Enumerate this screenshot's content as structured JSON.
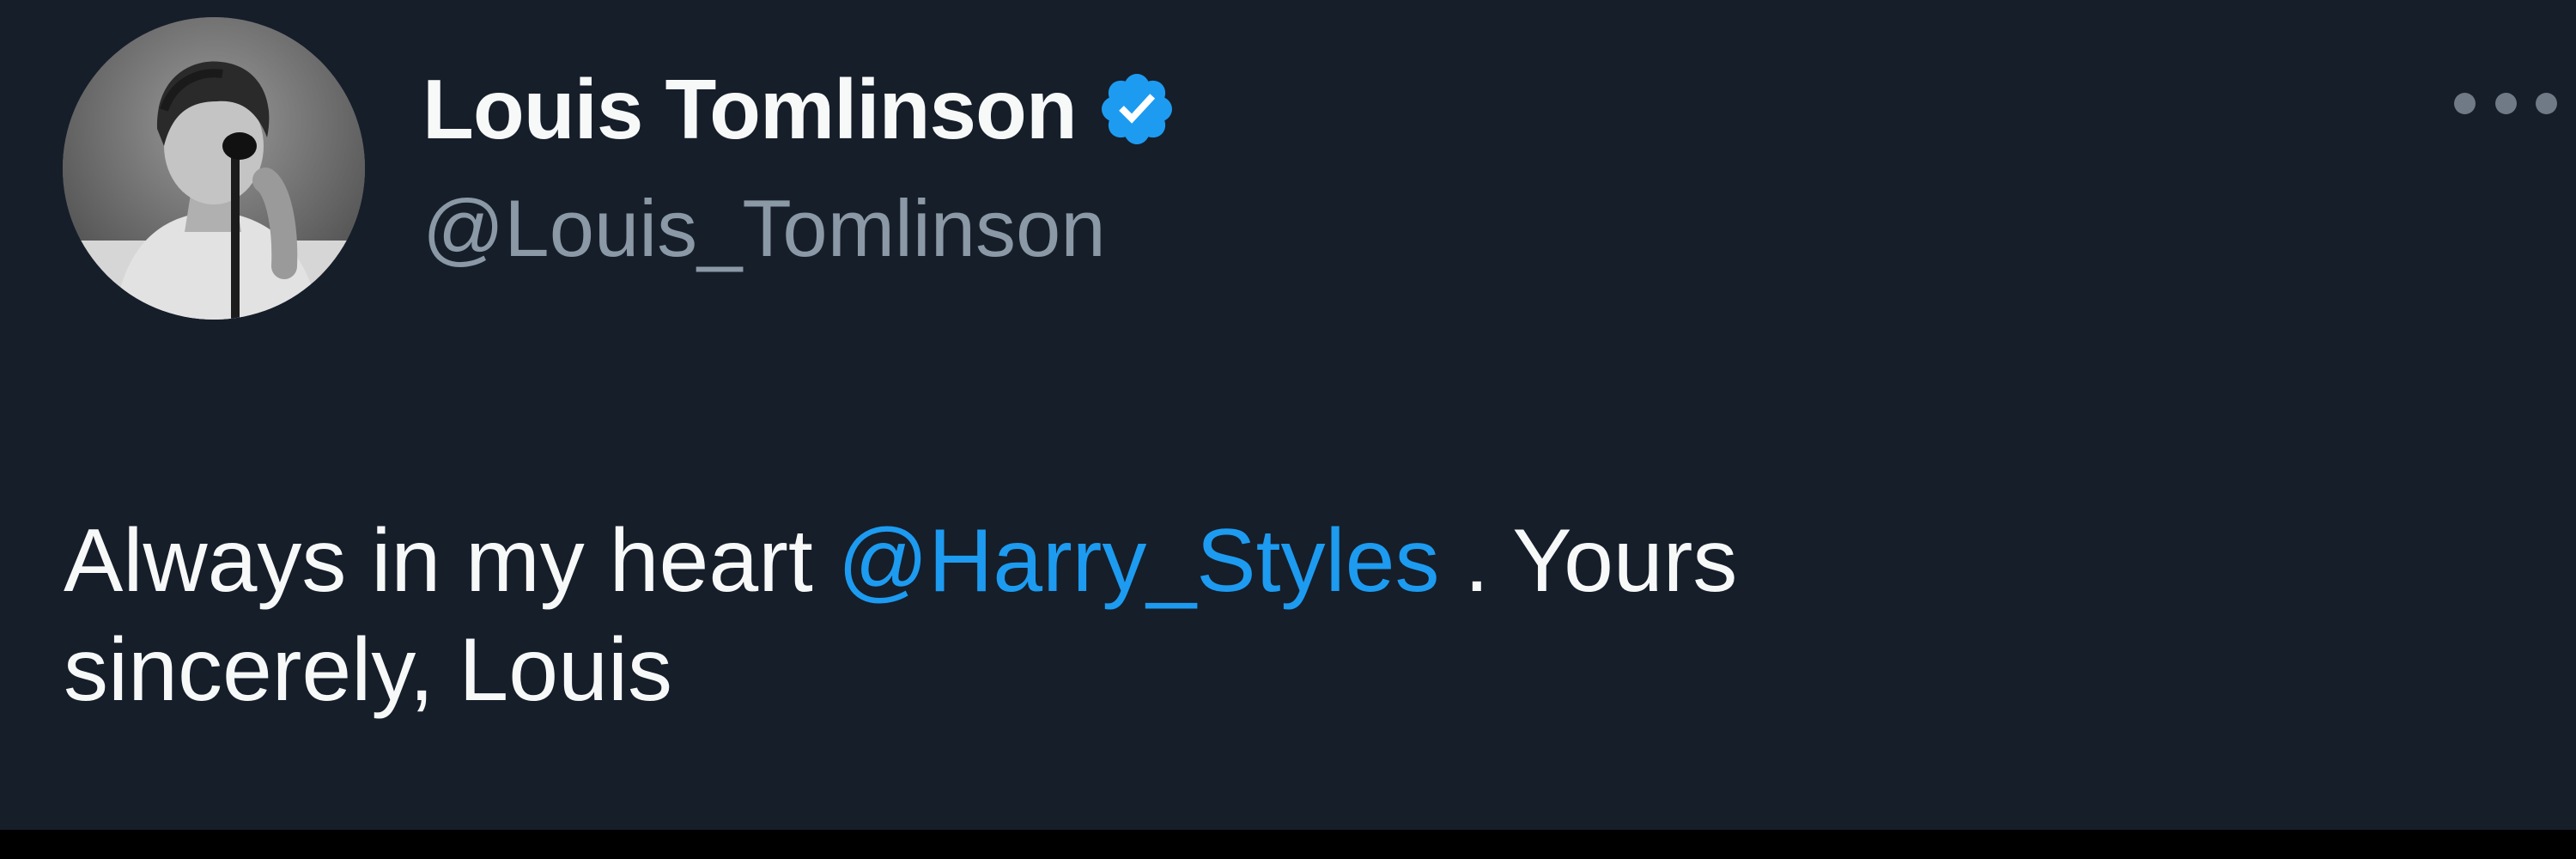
{
  "tweet": {
    "author": {
      "display_name": "Louis Tomlinson",
      "handle": "@Louis_Tomlinson",
      "verified": true,
      "avatar_icon": "profile-photo"
    },
    "more_icon": "more-options-icon",
    "text": {
      "line1_before": "Always in my heart ",
      "mention": "@Harry_Styles",
      "line1_after": " . Yours",
      "line2": "sincerely, Louis"
    }
  },
  "colors": {
    "background": "#161e2a",
    "text": "#f7f9f9",
    "secondary_text": "#8b98a5",
    "accent": "#1d9bf0"
  }
}
